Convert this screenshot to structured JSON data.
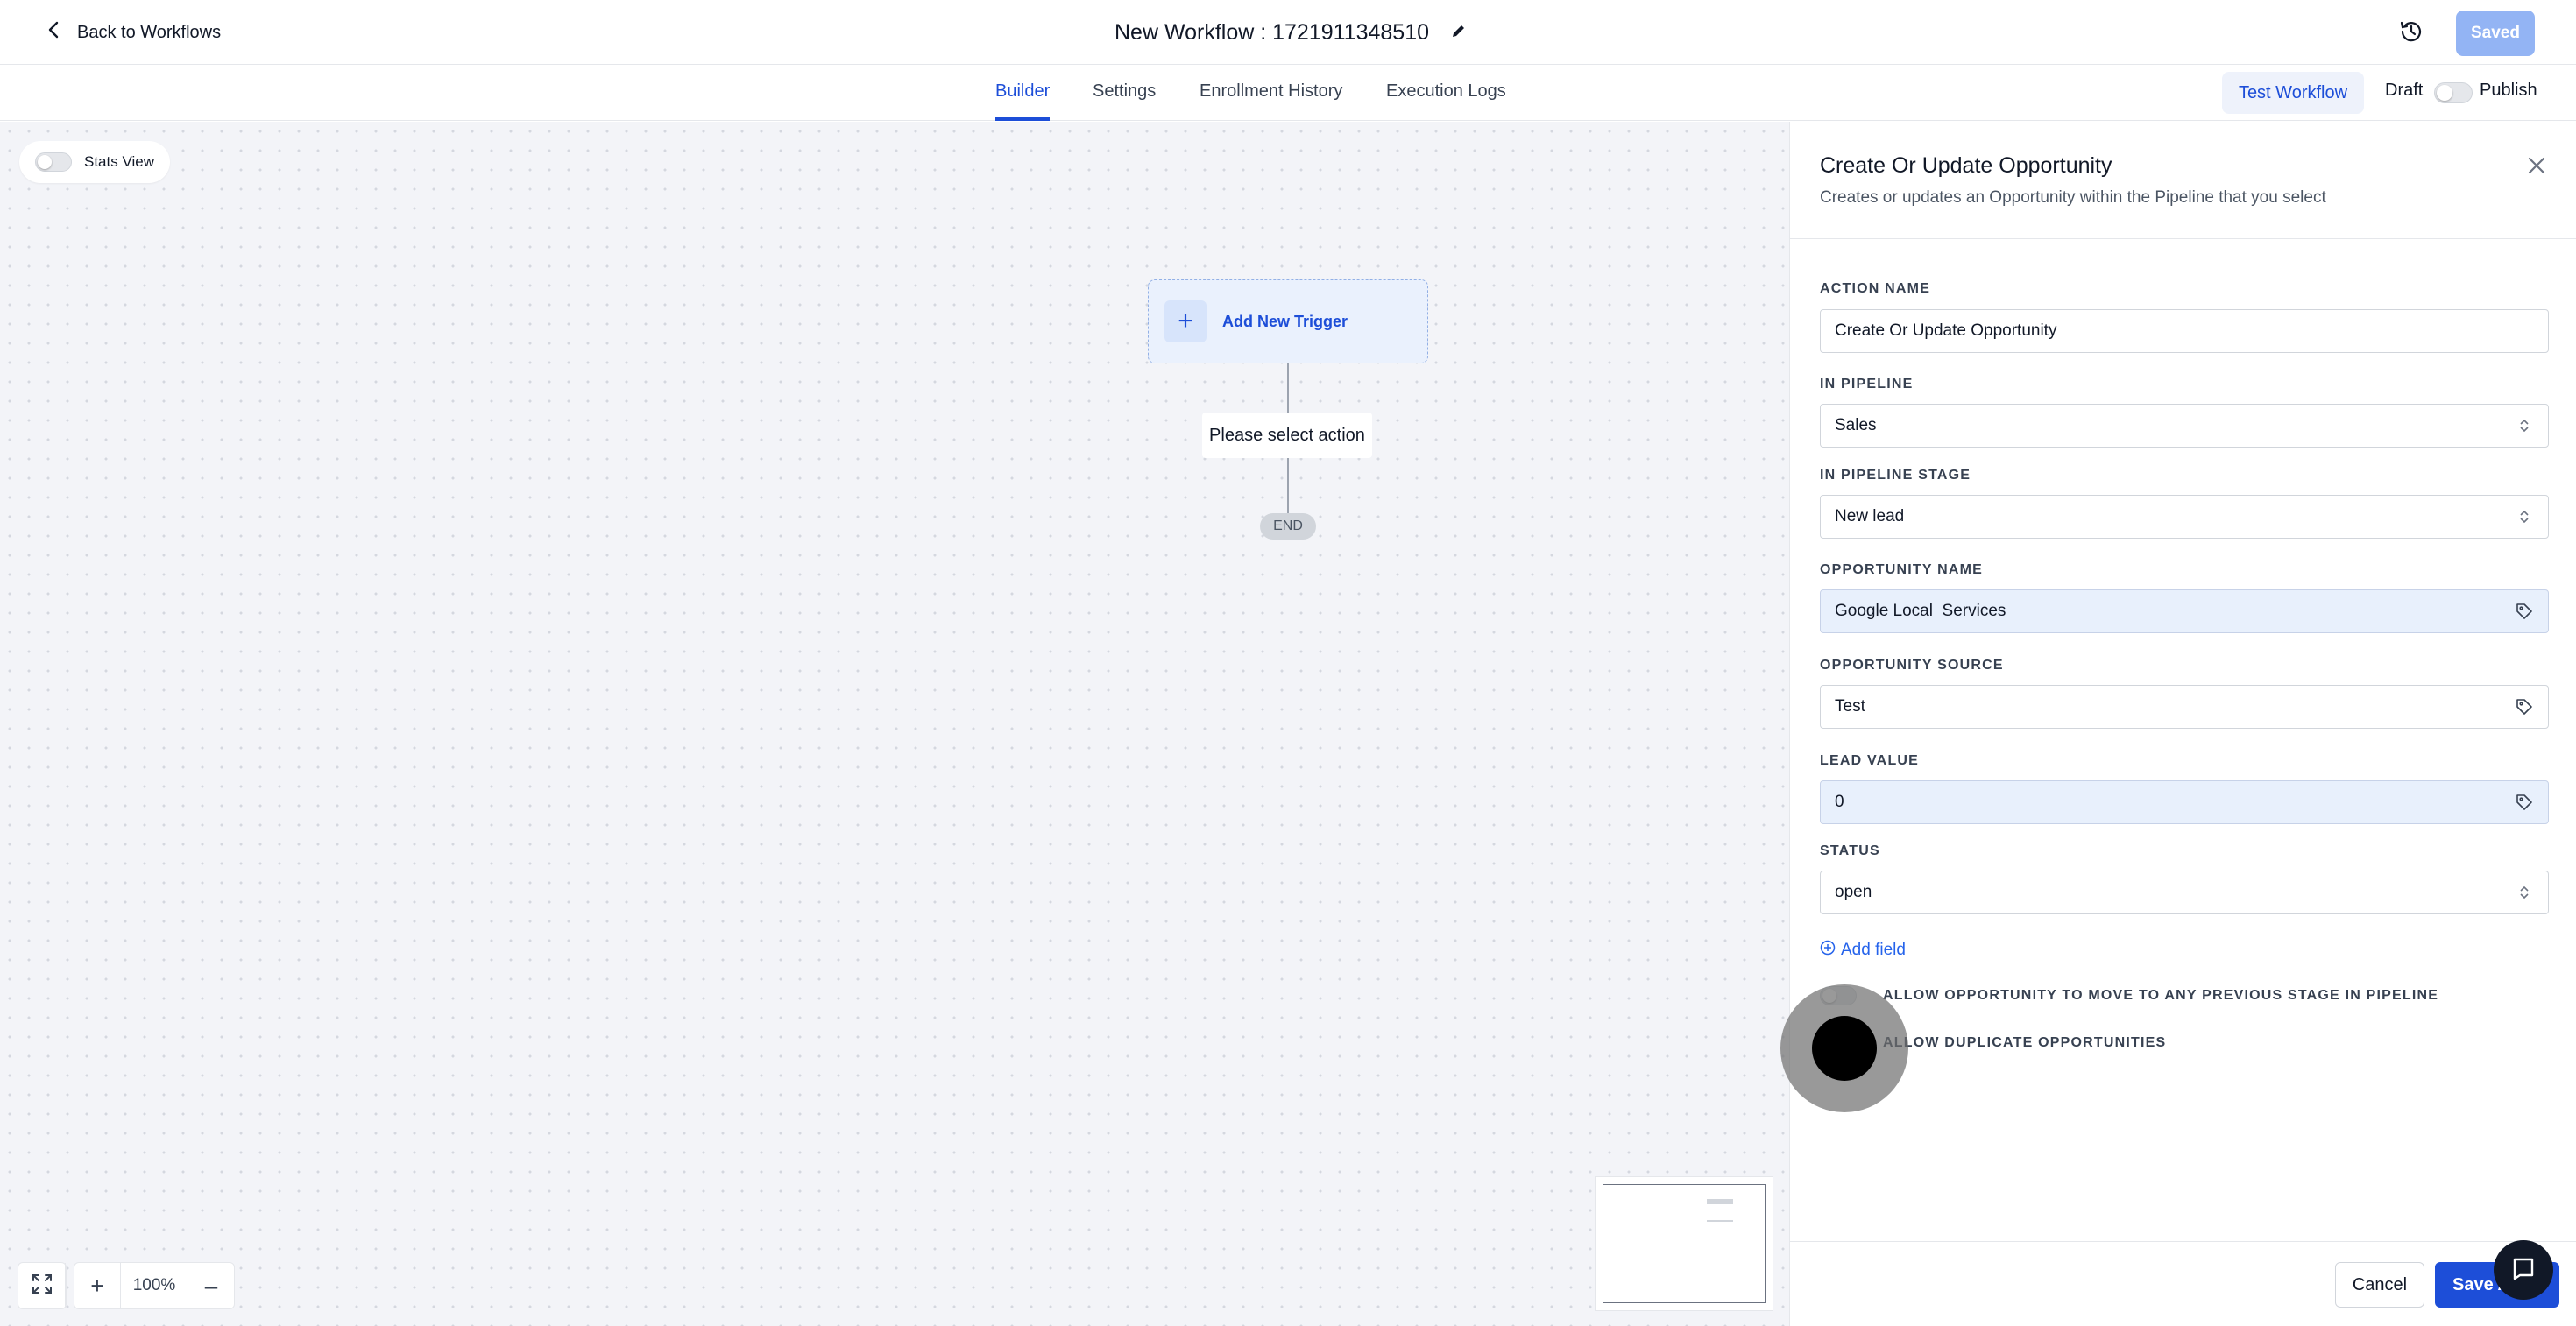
{
  "header": {
    "back_label": "Back to Workflows",
    "workflow_title": "New Workflow : 1721911348510",
    "saved_label": "Saved"
  },
  "tabs": [
    {
      "label": "Builder",
      "active": true
    },
    {
      "label": "Settings",
      "active": false
    },
    {
      "label": "Enrollment History",
      "active": false
    },
    {
      "label": "Execution Logs",
      "active": false
    }
  ],
  "toolbar": {
    "test_workflow_label": "Test Workflow",
    "draft_label": "Draft",
    "publish_label": "Publish",
    "publish_on": false
  },
  "canvas": {
    "stats_view_label": "Stats View",
    "stats_view_on": false,
    "trigger_label": "Add New Trigger",
    "action_placeholder": "Please select action",
    "end_label": "END",
    "zoom_level": "100%"
  },
  "panel": {
    "title": "Create Or Update Opportunity",
    "description": "Creates or updates an Opportunity within the Pipeline that you select",
    "fields": {
      "action_name": {
        "label": "ACTION NAME",
        "value": "Create Or Update Opportunity"
      },
      "pipeline": {
        "label": "IN PIPELINE",
        "value": "Sales"
      },
      "pipeline_stage": {
        "label": "IN PIPELINE STAGE",
        "value": "New lead"
      },
      "opportunity_name": {
        "label": "OPPORTUNITY NAME",
        "value": "Google Local  Services"
      },
      "opportunity_source": {
        "label": "OPPORTUNITY SOURCE",
        "value": "Test"
      },
      "lead_value": {
        "label": "LEAD VALUE",
        "value": "0"
      },
      "status": {
        "label": "STATUS",
        "value": "open"
      }
    },
    "add_field_label": "Add field",
    "options": {
      "allow_move": "ALLOW OPPORTUNITY TO MOVE TO ANY PREVIOUS STAGE IN PIPELINE",
      "allow_duplicate": "ALLOW DUPLICATE OPPORTUNITIES"
    },
    "cancel_label": "Cancel",
    "save_label": "Save A"
  },
  "colors": {
    "accent": "#1d4ed8",
    "saved_button": "#93b4f4",
    "canvas_bg": "#f3f4f8"
  }
}
